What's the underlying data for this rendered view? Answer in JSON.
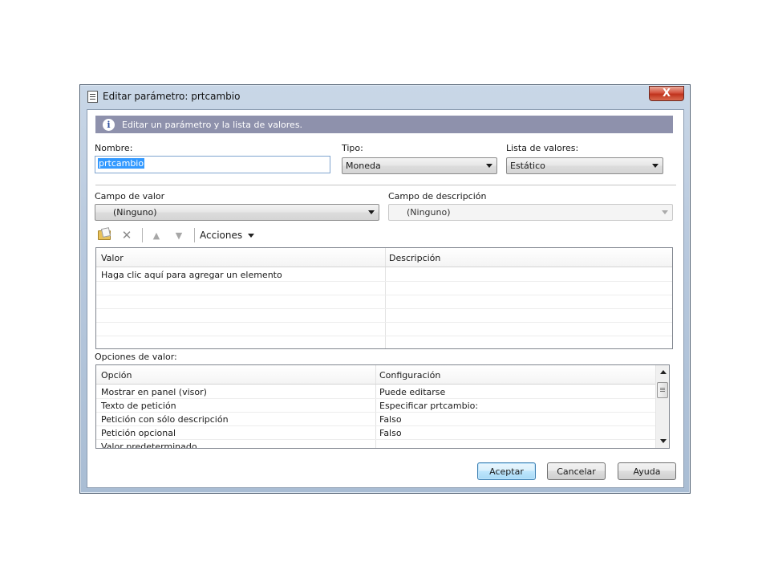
{
  "window": {
    "title": "Editar parámetro: prtcambio",
    "close_glyph": "X"
  },
  "info": {
    "icon_glyph": "i",
    "text": "Editar un parámetro y la lista de valores."
  },
  "form": {
    "nombre_label": "Nombre:",
    "nombre_value": "prtcambio",
    "tipo_label": "Tipo:",
    "tipo_value": "Moneda",
    "lista_label": "Lista de valores:",
    "lista_value": "Estático",
    "campo_valor_label": "Campo de valor",
    "campo_valor_value": "(Ninguno)",
    "campo_desc_label": "Campo de descripción",
    "campo_desc_value": "(Ninguno)"
  },
  "toolbar": {
    "acciones_label": "Acciones",
    "x_glyph": "✕",
    "up_glyph": "▲",
    "down_glyph": "▼"
  },
  "values_grid": {
    "columns": [
      "Valor",
      "Descripción"
    ],
    "placeholder_row": "Haga clic aquí para agregar un elemento"
  },
  "options": {
    "section_label": "Opciones de valor:",
    "columns": [
      "Opción",
      "Configuración"
    ],
    "rows": [
      {
        "option": "Mostrar en panel (visor)",
        "setting": "Puede editarse"
      },
      {
        "option": "Texto de petición",
        "setting": "Especificar prtcambio:"
      },
      {
        "option": "Petición con sólo descripción",
        "setting": "Falso"
      },
      {
        "option": "Petición opcional",
        "setting": "Falso"
      },
      {
        "option": "Valor predeterminado",
        "setting": ""
      }
    ]
  },
  "buttons": {
    "aceptar": "Aceptar",
    "cancelar": "Cancelar",
    "ayuda": "Ayuda"
  },
  "colors": {
    "infobar": "#8e91ac",
    "selection": "#3399ff",
    "close_button": "#c0331d"
  }
}
